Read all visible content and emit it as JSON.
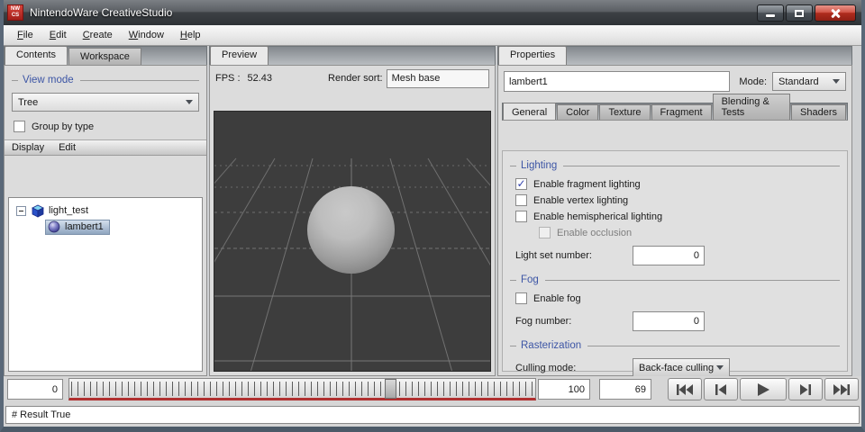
{
  "window": {
    "title": "NintendoWare CreativeStudio",
    "icon_line1": "NW",
    "icon_line2": "CS"
  },
  "menu": {
    "items": [
      "File",
      "Edit",
      "Create",
      "Window",
      "Help"
    ]
  },
  "left_panel": {
    "tabs": [
      {
        "label": "Contents",
        "active": true
      },
      {
        "label": "Workspace",
        "active": false
      }
    ],
    "view_mode": {
      "title": "View mode",
      "value": "Tree"
    },
    "group_by_type_label": "Group by type",
    "tree_menu": [
      "Display",
      "Edit"
    ],
    "tree": {
      "root_label": "light_test",
      "child_label": "lambert1",
      "root_icon": "cube-icon",
      "child_icon": "material-sphere-icon"
    }
  },
  "preview": {
    "tab": "Preview",
    "fps_label": "FPS :",
    "fps_value": "52.43",
    "render_sort_label": "Render sort:",
    "render_sort_value": "Mesh base"
  },
  "properties": {
    "tab": "Properties",
    "name_value": "lambert1",
    "mode_label": "Mode:",
    "mode_value": "Standard",
    "tabs": [
      "General",
      "Color",
      "Texture",
      "Fragment",
      "Blending & Tests",
      "Shaders"
    ],
    "active_tab": "General",
    "lighting": {
      "title": "Lighting",
      "checkboxes": [
        {
          "label": "Enable fragment lighting",
          "checked": true,
          "disabled": false
        },
        {
          "label": "Enable vertex lighting",
          "checked": false,
          "disabled": false
        },
        {
          "label": "Enable hemispherical lighting",
          "checked": false,
          "disabled": false
        },
        {
          "label": "Enable occlusion",
          "checked": false,
          "disabled": true
        }
      ],
      "light_set_label": "Light set number:",
      "light_set_value": "0"
    },
    "fog": {
      "title": "Fog",
      "enable_label": "Enable fog",
      "enable_checked": false,
      "number_label": "Fog number:",
      "number_value": "0"
    },
    "rasterization": {
      "title": "Rasterization",
      "culling_label": "Culling mode:",
      "culling_value": "Back-face culling"
    }
  },
  "timeline": {
    "start_value": "0",
    "end_value": "100",
    "current_value": "69",
    "position_percent": 69,
    "buttons": [
      "skip-to-start",
      "step-back",
      "play",
      "step-forward",
      "skip-to-end"
    ]
  },
  "status_bar": {
    "text": "# Result True"
  },
  "colors": {
    "accent_blue": "#3c55a5",
    "check_blue": "#3443ad",
    "selection_gradient": "#8fa5bf",
    "timeline_red": "#b03030",
    "viewport_background": "#3d3d3d",
    "close_button_red": "#b02c1e",
    "app_icon_red": "#c0332b"
  }
}
